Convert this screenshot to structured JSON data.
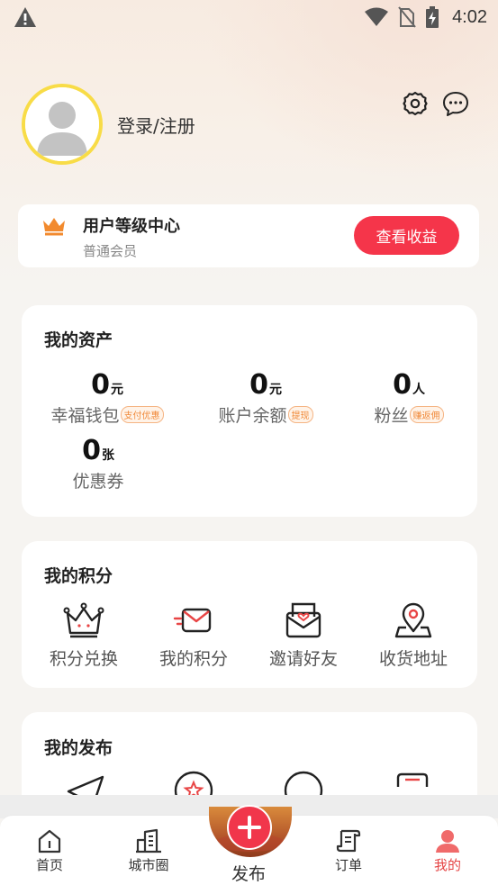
{
  "status_bar": {
    "time": "4:02"
  },
  "profile": {
    "login_text": "登录/注册"
  },
  "level_card": {
    "title": "用户等级中心",
    "subtitle": "普通会员",
    "earnings_button": "查看收益"
  },
  "assets": {
    "title": "我的资产",
    "items": [
      {
        "value": "0",
        "unit": "元",
        "label": "幸福钱包",
        "tag": "支付优惠"
      },
      {
        "value": "0",
        "unit": "元",
        "label": "账户余额",
        "tag": "提现"
      },
      {
        "value": "0",
        "unit": "人",
        "label": "粉丝",
        "tag": "赚返佣"
      },
      {
        "value": "0",
        "unit": "张",
        "label": "优惠券",
        "tag": ""
      }
    ]
  },
  "points": {
    "title": "我的积分",
    "items": [
      {
        "label": "积分兑换",
        "icon": "crown-outline-icon"
      },
      {
        "label": "我的积分",
        "icon": "fast-mail-icon"
      },
      {
        "label": "邀请好友",
        "icon": "heart-envelope-icon"
      },
      {
        "label": "收货地址",
        "icon": "location-pin-icon"
      }
    ]
  },
  "publish_section": {
    "title": "我的发布"
  },
  "bottom_nav": {
    "items": [
      {
        "label": "首页",
        "icon": "home-icon"
      },
      {
        "label": "城市圈",
        "icon": "city-building-icon"
      },
      {
        "label": "发布",
        "icon": "plus-icon"
      },
      {
        "label": "订单",
        "icon": "order-scroll-icon"
      },
      {
        "label": "我的",
        "icon": "user-icon"
      }
    ],
    "active": "我的"
  },
  "colors": {
    "accent": "#f5354a",
    "avatar_ring": "#f8dc47",
    "crown": "#f28a2e",
    "tag_text": "#f08a3a"
  }
}
